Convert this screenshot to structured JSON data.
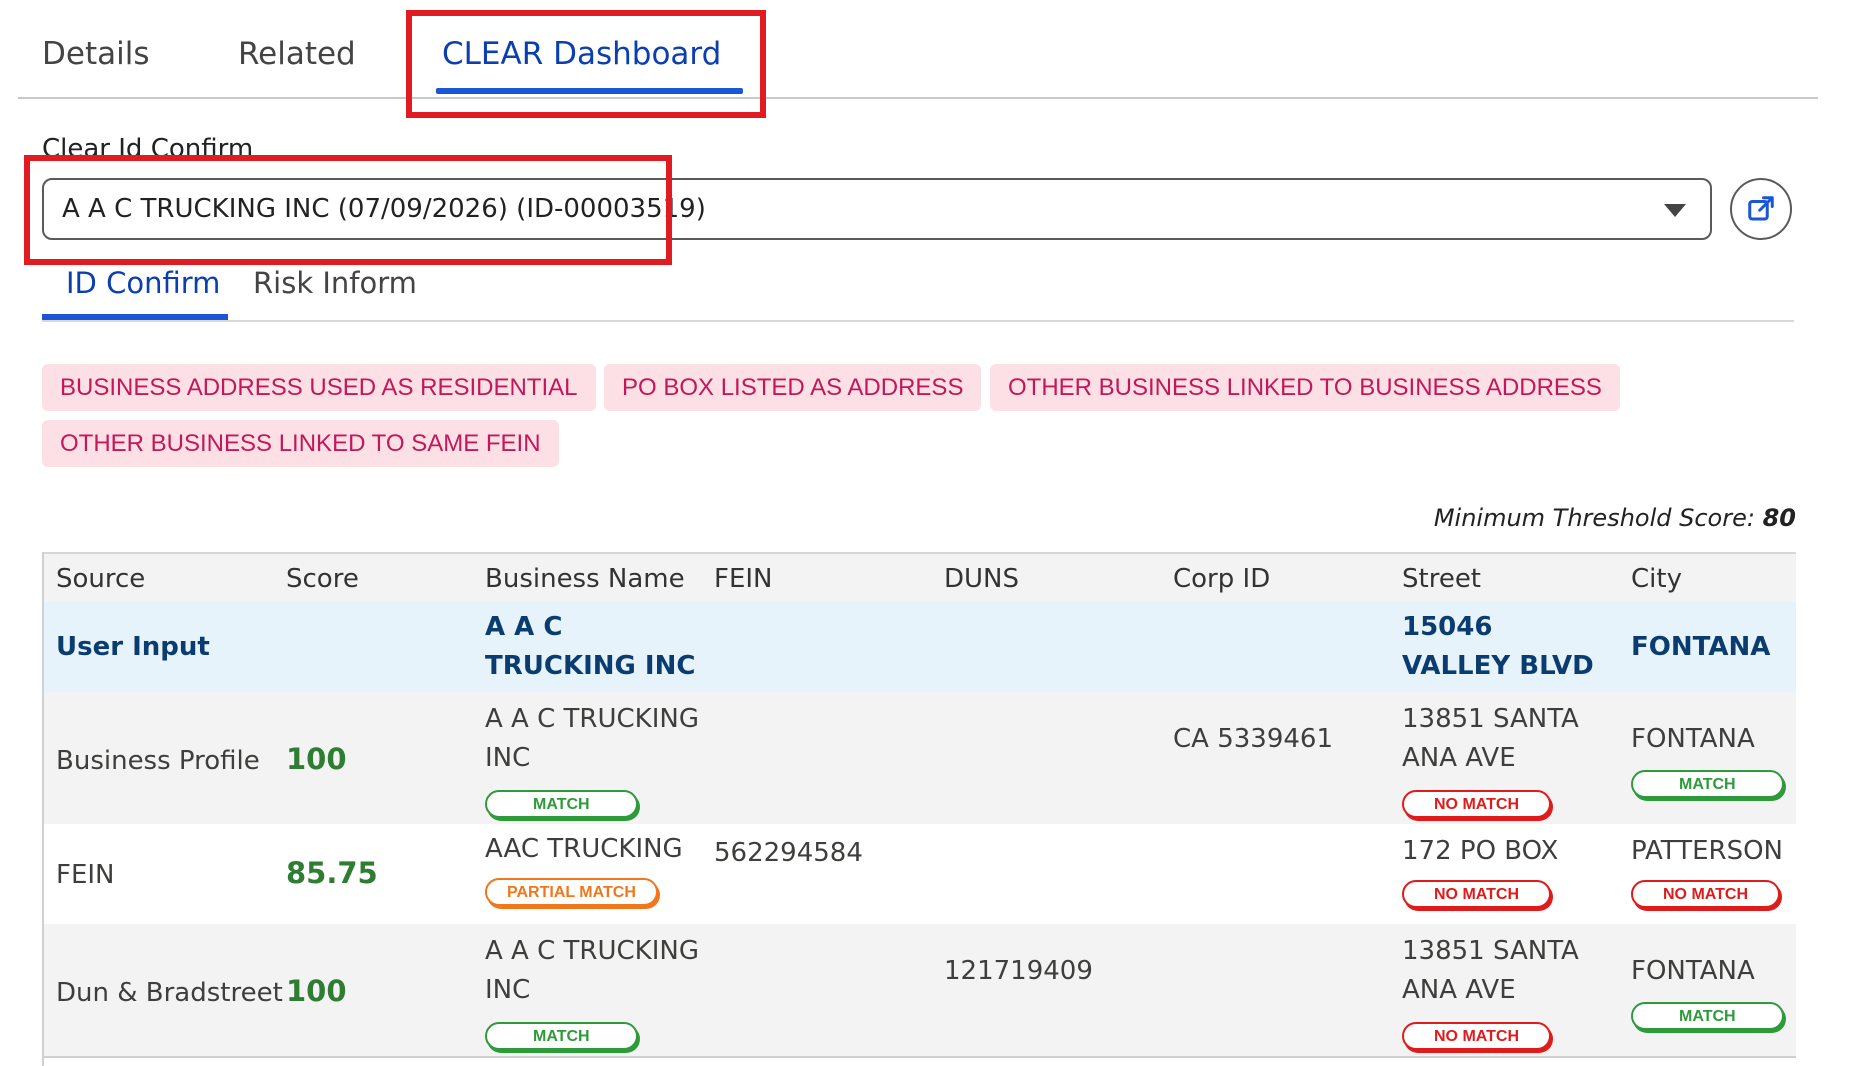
{
  "top_tabs": [
    {
      "label": "Details"
    },
    {
      "label": "Related"
    },
    {
      "label": "CLEAR Dashboard"
    }
  ],
  "clear_id": {
    "label": "Clear Id Confirm",
    "selected": "A A C TRUCKING INC (07/09/2026) (ID-00003519)"
  },
  "sub_tabs": [
    {
      "label": "ID Confirm"
    },
    {
      "label": "Risk Inform"
    }
  ],
  "flags": [
    "BUSINESS ADDRESS USED AS RESIDENTIAL",
    "PO BOX LISTED AS ADDRESS",
    "OTHER BUSINESS LINKED TO BUSINESS ADDRESS",
    "OTHER BUSINESS LINKED TO SAME FEIN"
  ],
  "threshold": {
    "label": "Minimum Threshold Score:",
    "value": "80"
  },
  "table": {
    "columns": [
      "Source",
      "Score",
      "Business Name",
      "FEIN",
      "DUNS",
      "Corp ID",
      "Street",
      "City"
    ],
    "user_input": {
      "source": "User Input",
      "business_name": "A A C TRUCKING INC",
      "street": "15046 VALLEY BLVD",
      "city": "FONTANA"
    },
    "rows": [
      {
        "source": "Business Profile",
        "score": "100",
        "business_name": "A A C TRUCKING INC",
        "business_name_status": "MATCH",
        "corp_id": "CA 5339461",
        "street": "13851 SANTA ANA AVE",
        "street_status": "NO MATCH",
        "city": "FONTANA",
        "city_status": "MATCH"
      },
      {
        "source": "FEIN",
        "score": "85.75",
        "business_name": "AAC TRUCKING",
        "business_name_status": "PARTIAL MATCH",
        "fein": "562294584",
        "street": "172 PO BOX",
        "street_status": "NO MATCH",
        "city": "PATTERSON",
        "city_status": "NO MATCH"
      },
      {
        "source": "Dun & Bradstreet",
        "score": "100",
        "business_name": "A A C TRUCKING INC",
        "business_name_status": "MATCH",
        "duns": "121719409",
        "street": "13851 SANTA ANA AVE",
        "street_status": "NO MATCH",
        "city": "FONTANA",
        "city_status": "MATCH"
      }
    ]
  },
  "icons": {
    "external_link": "external-link-icon",
    "dropdown": "chevron-down-icon"
  },
  "colors": {
    "accent": "#1a56d6",
    "highlight_red": "#e11b22",
    "flag_bg": "#fde0e6",
    "flag_text": "#c2185b",
    "match": "#2e9b3a",
    "no_match": "#e01b1b",
    "partial": "#f0771b"
  }
}
